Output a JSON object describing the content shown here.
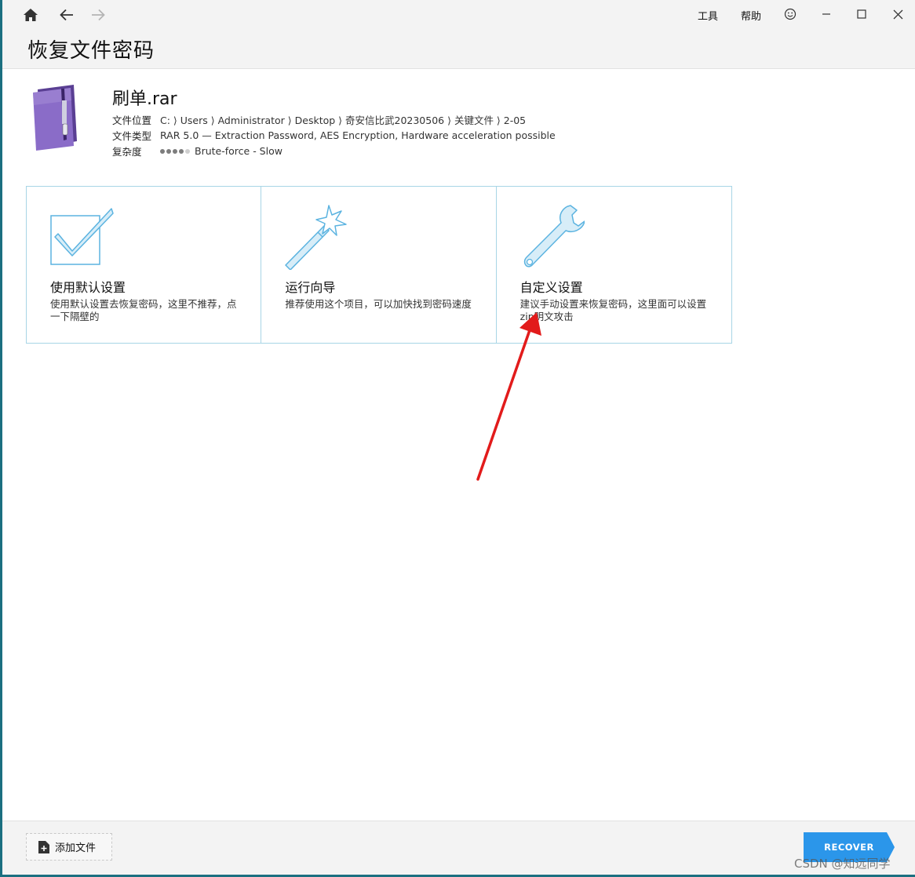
{
  "header": {
    "menu": {
      "tools": "工具",
      "help": "帮助"
    },
    "page_title": "恢复文件密码"
  },
  "file": {
    "name": "刷单.rar",
    "location_label": "文件位置",
    "location_value": "C: ⟩ Users ⟩ Administrator ⟩ Desktop ⟩ 奇安信比武20230506 ⟩ 关键文件 ⟩ 2-05",
    "type_label": "文件类型",
    "type_value": "RAR 5.0 — Extraction Password, AES Encryption, Hardware acceleration possible",
    "complexity_label": "复杂度",
    "complexity_level": 4,
    "complexity_max": 5,
    "complexity_value": "Brute-force - Slow"
  },
  "cards": [
    {
      "title": "使用默认设置",
      "desc": "使用默认设置去恢复密码，这里不推荐，点一下隔壁的",
      "icon": "checkbox-icon"
    },
    {
      "title": "运行向导",
      "desc": "推荐使用这个项目，可以加快找到密码速度",
      "icon": "magic-wand-icon"
    },
    {
      "title": "自定义设置",
      "desc": "建议手动设置来恢复密码，这里面可以设置zip明文攻击",
      "icon": "wrench-icon"
    }
  ],
  "footer": {
    "add_file_label": "添加文件",
    "recover_label": "RECOVER"
  },
  "watermark": "CSDN @知远同学",
  "colors": {
    "accent_blue": "#2b96ea",
    "card_border": "#a8d5e6",
    "icon_blue": "#5bb3e0",
    "annotation_red": "#e21b1b",
    "archive_purple": "#7b5bb5"
  }
}
